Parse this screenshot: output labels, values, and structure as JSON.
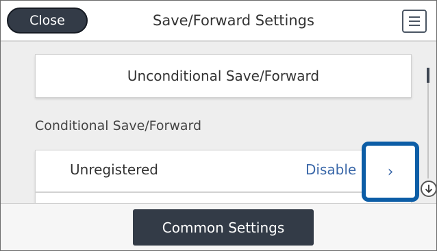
{
  "header": {
    "close_label": "Close",
    "title": "Save/Forward Settings"
  },
  "main": {
    "unconditional_label": "Unconditional Save/Forward",
    "section_label": "Conditional Save/Forward",
    "rows": [
      {
        "label": "Unregistered",
        "value": "Disable",
        "chevron": "›"
      }
    ]
  },
  "footer": {
    "common_settings_label": "Common Settings"
  },
  "icons": {
    "menu": "menu-icon",
    "chevron": "chevron-right-icon",
    "scroll_down": "arrow-down-icon"
  },
  "colors": {
    "dark_button": "#333b47",
    "highlight": "#0c5da6",
    "value_text": "#3b68a9"
  }
}
